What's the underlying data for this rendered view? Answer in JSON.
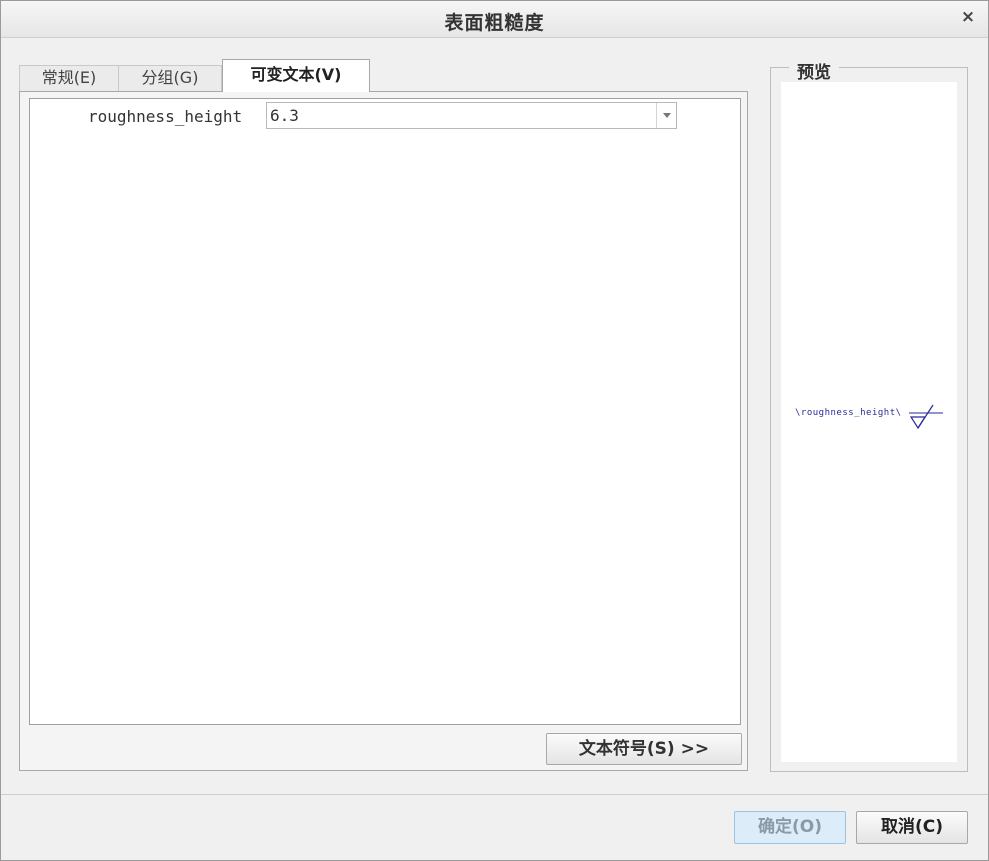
{
  "window": {
    "title": "表面粗糙度",
    "close_glyph": "×"
  },
  "tabs": [
    {
      "label": "常规(E)",
      "active": false
    },
    {
      "label": "分组(G)",
      "active": false
    },
    {
      "label": "可变文本(V)",
      "active": true
    }
  ],
  "variable_text": {
    "rows": [
      {
        "name": "roughness_height",
        "value": "6.3"
      }
    ]
  },
  "text_symbol_button": "文本符号(S) >>",
  "preview": {
    "legend": "预览",
    "annotation_text": "\\roughness_height\\",
    "symbol_icon": "surface-roughness-symbol",
    "annotation_color": "#2a2a9a"
  },
  "buttons": {
    "ok": "确定(O)",
    "cancel": "取消(C)"
  },
  "colors": {
    "ok_button_bg": "#dcecf8"
  }
}
